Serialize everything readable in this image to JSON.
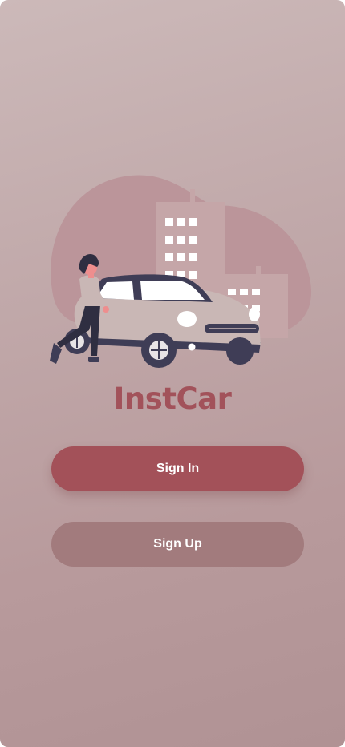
{
  "app": {
    "title": "InstCar"
  },
  "actions": {
    "sign_in_label": "Sign In",
    "sign_up_label": "Sign Up"
  },
  "illustration": {
    "subject": "woman leaning on car in front of city buildings"
  },
  "colors": {
    "background_top": "#ccb9b9",
    "background_bottom": "#b09294",
    "brand": "#a2525a",
    "primary_button": "#a35159",
    "secondary_button": "#a27b7d",
    "button_text": "#ffffff"
  }
}
